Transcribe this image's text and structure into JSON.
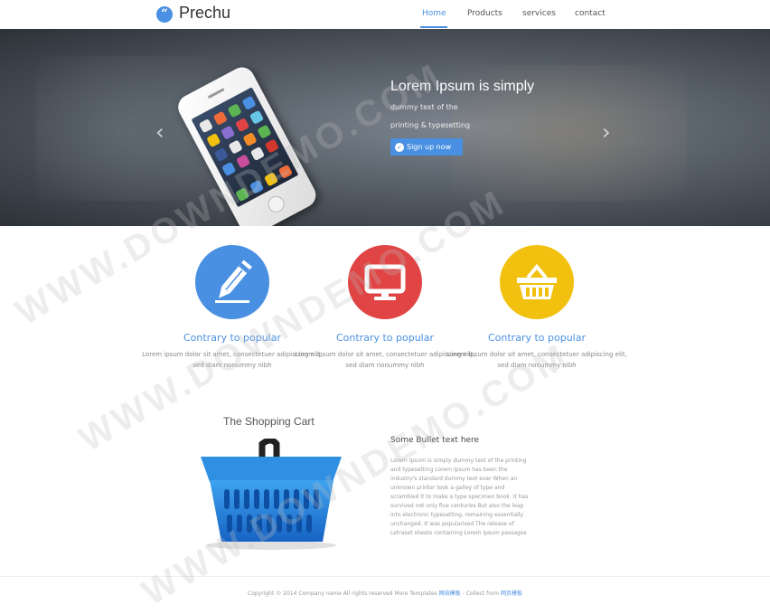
{
  "header": {
    "logo_icon": "“",
    "logo_text": "Prechu",
    "nav": [
      "Home",
      "Products",
      "services",
      "contact"
    ]
  },
  "hero": {
    "title": "Lorem Ipsum is simply",
    "line1": "dummy text of the",
    "line2": "printing & typesetting",
    "cta": "Sign up now",
    "prev_arrow": "‹",
    "next_arrow": "›"
  },
  "features": [
    {
      "icon": "pencil-icon",
      "color": "#4a90e2",
      "title": "Contrary to popular",
      "text": "Lorem ipsum dolor sit amet, consectetuer adipiscing elit, sed diam nonummy nibh"
    },
    {
      "icon": "monitor-icon",
      "color": "#e04444",
      "title": "Contrary to popular",
      "text": "Lorem ipsum dolor sit amet, consectetuer adipiscing elit, sed diam nonummy nibh"
    },
    {
      "icon": "basket-icon",
      "color": "#f2c10f",
      "title": "Contrary to popular",
      "text": "Lorem ipsum dolor sit amet, consectetuer adipiscing elit, sed diam nonummy nibh"
    }
  ],
  "shopping": {
    "title": "The Shopping Cart",
    "bullet_title": "Some Bullet text here",
    "bullet_body": "Lorem Ipsum is simply dummy text of the printing and typesetting Lorem Ipsum has been the industry's standard dummy text ever When an unknown printer took a galley of type and scrambled it to make a type specimen book. It has survived not only five centuries But also the leap into electronic typesetting, remaining essentially unchanged. It was popularised The release of Letraset sheets containing Lorem Ipsum passages"
  },
  "footer": {
    "text": "Copyright © 2014 Company name All rights reserved More Templates",
    "link1": "网站模板",
    "middle": " - Collect from ",
    "link2": "网页模板"
  },
  "watermark": "WWW.DOWNDEMO.COM"
}
